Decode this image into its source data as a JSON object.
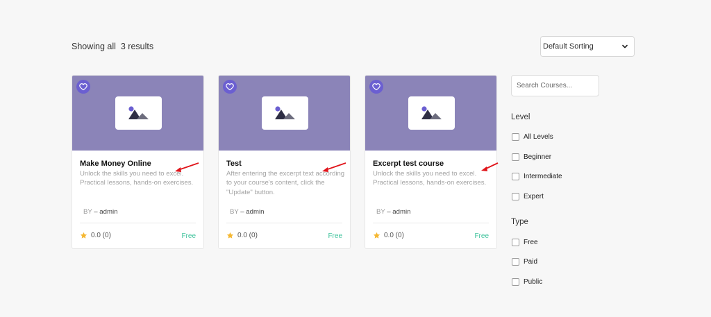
{
  "header": {
    "results_text": "Showing all  3 results",
    "sort": {
      "selected": "Default Sorting"
    }
  },
  "courses": [
    {
      "title": "Make Money Online",
      "excerpt": "Unlock the skills you need to excel. Practical lessons, hands-on exercises.",
      "by_label": "BY",
      "author": "– admin",
      "rating": "0.0 (0)",
      "price": "Free"
    },
    {
      "title": "Test",
      "excerpt": "After entering the excerpt text according to your course's content, click the \"Update\" button.",
      "by_label": "BY",
      "author": "– admin",
      "rating": "0.0 (0)",
      "price": "Free"
    },
    {
      "title": "Excerpt test course",
      "excerpt": "Unlock the skills you need to excel. Practical lessons, hands-on exercises.",
      "by_label": "BY",
      "author": "– admin",
      "rating": "0.0 (0)",
      "price": "Free"
    }
  ],
  "sidebar": {
    "search_placeholder": "Search Courses...",
    "level": {
      "heading": "Level",
      "options": [
        "All Levels",
        "Beginner",
        "Intermediate",
        "Expert"
      ]
    },
    "type": {
      "heading": "Type",
      "options": [
        "Free",
        "Paid",
        "Public"
      ]
    }
  },
  "colors": {
    "thumbnail_bg": "#8b84b8",
    "heart_bg": "#6b5fd1",
    "price_free": "#3fc39c",
    "star": "#f5b731",
    "annotation_arrow": "#e0141a"
  },
  "icons": [
    "heart-icon",
    "image-placeholder-icon",
    "star-icon",
    "chevron-down-icon"
  ]
}
